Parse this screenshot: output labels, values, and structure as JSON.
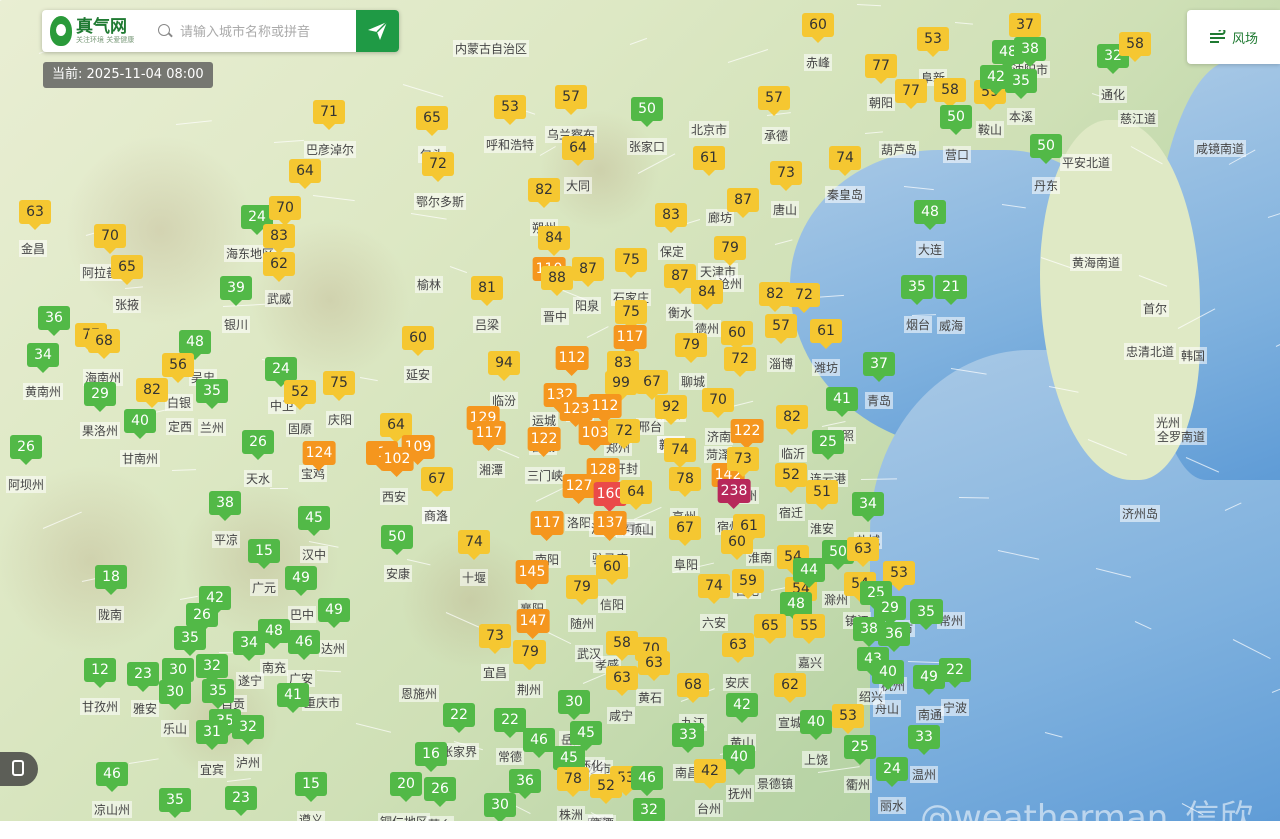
{
  "header": {
    "logo_name": "真气网",
    "logo_slogan": "关注环境 关爱健康",
    "search_placeholder": "请输入城市名称或拼音",
    "timestamp": "当前: 2025-11-04 08:00"
  },
  "controls": {
    "wind_label": "风场"
  },
  "watermark": "@weatherman_信欣",
  "colors": {
    "good": "#52b947",
    "moderate": "#f5c731",
    "light": "#f5961e",
    "medium": "#ea4a4a",
    "heavy": "#b7285a",
    "brand": "#1f9a45"
  },
  "aqi_markers": [
    {
      "v": "37"
    },
    {
      "v": "60"
    },
    {
      "v": "53"
    },
    {
      "v": "48"
    },
    {
      "v": "38"
    },
    {
      "v": "32"
    },
    {
      "v": "58"
    },
    {
      "v": "77"
    },
    {
      "v": "77"
    },
    {
      "v": "58"
    },
    {
      "v": "59"
    },
    {
      "v": "42"
    },
    {
      "v": "35"
    },
    {
      "v": "57"
    },
    {
      "v": "50"
    },
    {
      "v": "57"
    },
    {
      "v": "53"
    },
    {
      "v": "71"
    },
    {
      "v": "65"
    },
    {
      "v": "72"
    },
    {
      "v": "50"
    },
    {
      "v": "64"
    },
    {
      "v": "61"
    },
    {
      "v": "73"
    },
    {
      "v": "74"
    },
    {
      "v": "64"
    },
    {
      "v": "82"
    },
    {
      "v": "50"
    },
    {
      "v": "48"
    },
    {
      "v": "63"
    },
    {
      "v": "24"
    },
    {
      "v": "70"
    },
    {
      "v": "83"
    },
    {
      "v": "70"
    },
    {
      "v": "84"
    },
    {
      "v": "87"
    },
    {
      "v": "83"
    },
    {
      "v": "79"
    },
    {
      "v": "65"
    },
    {
      "v": "62"
    },
    {
      "v": "75"
    },
    {
      "v": "110"
    },
    {
      "v": "87"
    },
    {
      "v": "88"
    },
    {
      "v": "87"
    },
    {
      "v": "84"
    },
    {
      "v": "82"
    },
    {
      "v": "72"
    },
    {
      "v": "35"
    },
    {
      "v": "21"
    },
    {
      "v": "39"
    },
    {
      "v": "81"
    },
    {
      "v": "75"
    },
    {
      "v": "36"
    },
    {
      "v": "77"
    },
    {
      "v": "68"
    },
    {
      "v": "48"
    },
    {
      "v": "60"
    },
    {
      "v": "117"
    },
    {
      "v": "60"
    },
    {
      "v": "57"
    },
    {
      "v": "61"
    },
    {
      "v": "34"
    },
    {
      "v": "56"
    },
    {
      "v": "24"
    },
    {
      "v": "94"
    },
    {
      "v": "112"
    },
    {
      "v": "83"
    },
    {
      "v": "79"
    },
    {
      "v": "72"
    },
    {
      "v": "37"
    },
    {
      "v": "29"
    },
    {
      "v": "82"
    },
    {
      "v": "35"
    },
    {
      "v": "52"
    },
    {
      "v": "75"
    },
    {
      "v": "99"
    },
    {
      "v": "67"
    },
    {
      "v": "132"
    },
    {
      "v": "112"
    },
    {
      "v": "123"
    },
    {
      "v": "92"
    },
    {
      "v": "70"
    },
    {
      "v": "82"
    },
    {
      "v": "41"
    },
    {
      "v": "40"
    },
    {
      "v": "129"
    },
    {
      "v": "117"
    },
    {
      "v": "64"
    },
    {
      "v": "103"
    },
    {
      "v": "72"
    },
    {
      "v": "122"
    },
    {
      "v": "122"
    },
    {
      "v": "26"
    },
    {
      "v": "26"
    },
    {
      "v": "109"
    },
    {
      "v": "124"
    },
    {
      "v": "1"
    },
    {
      "v": "102"
    },
    {
      "v": "74"
    },
    {
      "v": "25"
    },
    {
      "v": "142"
    },
    {
      "v": "73"
    },
    {
      "v": "128"
    },
    {
      "v": "67"
    },
    {
      "v": "127"
    },
    {
      "v": "160"
    },
    {
      "v": "64"
    },
    {
      "v": "78"
    },
    {
      "v": "238"
    },
    {
      "v": "52"
    },
    {
      "v": "51"
    },
    {
      "v": "38"
    },
    {
      "v": "117"
    },
    {
      "v": "137"
    },
    {
      "v": "67"
    },
    {
      "v": "61"
    },
    {
      "v": "34"
    },
    {
      "v": "45"
    },
    {
      "v": "50"
    },
    {
      "v": "74"
    },
    {
      "v": "60"
    },
    {
      "v": "50"
    },
    {
      "v": "63"
    },
    {
      "v": "15"
    },
    {
      "v": "60"
    },
    {
      "v": "54"
    },
    {
      "v": "54"
    },
    {
      "v": "44"
    },
    {
      "v": "145"
    },
    {
      "v": "18"
    },
    {
      "v": "49"
    },
    {
      "v": "79"
    },
    {
      "v": "74"
    },
    {
      "v": "59"
    },
    {
      "v": "54"
    },
    {
      "v": "53"
    },
    {
      "v": "42"
    },
    {
      "v": "25"
    },
    {
      "v": "49"
    },
    {
      "v": "26"
    },
    {
      "v": "49"
    },
    {
      "v": "48"
    },
    {
      "v": "35"
    },
    {
      "v": "29"
    },
    {
      "v": "35"
    },
    {
      "v": "48"
    },
    {
      "v": "46"
    },
    {
      "v": "147"
    },
    {
      "v": "79"
    },
    {
      "v": "73"
    },
    {
      "v": "58"
    },
    {
      "v": "70"
    },
    {
      "v": "63"
    },
    {
      "v": "65"
    },
    {
      "v": "55"
    },
    {
      "v": "38"
    },
    {
      "v": "36"
    },
    {
      "v": "34"
    },
    {
      "v": "32"
    },
    {
      "v": "12"
    },
    {
      "v": "23"
    },
    {
      "v": "30"
    },
    {
      "v": "79"
    },
    {
      "v": "63"
    },
    {
      "v": "63"
    },
    {
      "v": "43"
    },
    {
      "v": "40"
    },
    {
      "v": "22"
    },
    {
      "v": "49"
    },
    {
      "v": "35"
    },
    {
      "v": "30"
    },
    {
      "v": "41"
    },
    {
      "v": "30"
    },
    {
      "v": "68"
    },
    {
      "v": "62"
    },
    {
      "v": "35"
    },
    {
      "v": "32"
    },
    {
      "v": "22"
    },
    {
      "v": "22"
    },
    {
      "v": "42"
    },
    {
      "v": "53"
    },
    {
      "v": "40"
    },
    {
      "v": "31"
    },
    {
      "v": "33"
    },
    {
      "v": "46"
    },
    {
      "v": "33"
    },
    {
      "v": "25"
    },
    {
      "v": "45"
    },
    {
      "v": "40"
    },
    {
      "v": "16"
    },
    {
      "v": "45"
    },
    {
      "v": "46"
    },
    {
      "v": "24"
    },
    {
      "v": "42"
    },
    {
      "v": "78"
    },
    {
      "v": "53"
    },
    {
      "v": "52"
    },
    {
      "v": "46"
    },
    {
      "v": "36"
    },
    {
      "v": "20"
    },
    {
      "v": "26"
    },
    {
      "v": "15"
    },
    {
      "v": "23"
    },
    {
      "v": "35"
    },
    {
      "v": "46"
    },
    {
      "v": "30"
    },
    {
      "v": "32"
    }
  ],
  "aqi_levels": [
    2,
    2,
    2,
    1,
    1,
    1,
    2,
    2,
    2,
    2,
    2,
    1,
    1,
    2,
    1,
    2,
    2,
    2,
    2,
    2,
    1,
    2,
    2,
    2,
    2,
    2,
    2,
    1,
    1,
    2,
    1,
    2,
    2,
    2,
    2,
    2,
    2,
    2,
    2,
    2,
    2,
    3,
    2,
    2,
    2,
    2,
    2,
    2,
    1,
    1,
    1,
    2,
    2,
    1,
    2,
    2,
    1,
    2,
    3,
    2,
    2,
    2,
    1,
    2,
    1,
    2,
    3,
    2,
    2,
    2,
    1,
    1,
    2,
    1,
    2,
    2,
    2,
    2,
    3,
    3,
    3,
    2,
    2,
    2,
    1,
    1,
    3,
    3,
    2,
    3,
    2,
    3,
    3,
    1,
    1,
    3,
    3,
    3,
    3,
    2,
    1,
    3,
    2,
    3,
    2,
    3,
    4,
    2,
    2,
    5,
    2,
    2,
    1,
    3,
    3,
    2,
    2,
    1,
    1,
    1,
    2,
    2,
    1,
    2,
    1,
    2,
    2,
    2,
    1,
    3,
    1,
    1,
    2,
    2,
    2,
    2,
    2,
    1,
    1,
    1,
    1,
    1,
    1,
    1,
    1,
    1,
    1,
    1,
    3,
    2,
    2,
    2,
    2,
    2,
    2,
    2,
    1,
    1,
    1,
    1,
    1,
    1,
    1,
    2,
    2,
    2,
    1,
    1,
    1,
    1,
    1,
    1,
    1,
    1,
    2,
    2,
    1,
    1,
    1,
    1,
    1,
    2,
    1,
    1,
    1,
    1,
    1,
    1,
    1,
    1,
    1,
    1,
    1,
    1,
    2,
    2,
    2,
    2,
    1,
    1,
    1,
    1,
    1,
    1,
    1,
    1,
    1,
    1
  ],
  "city_labels": [
    "内蒙古自治区",
    "赤峰",
    "阜新",
    "沈阳市",
    "通化",
    "丹东",
    "鞍山",
    "营口",
    "葫芦岛",
    "朝阳",
    "本溪",
    "平安北道",
    "慈江道",
    "咸镜南道",
    "北京市",
    "张家口",
    "承德",
    "秦皇岛",
    "唐山",
    "天津市",
    "廊坊",
    "保定",
    "沧州",
    "石家庄",
    "衡水",
    "德州",
    "阳泉",
    "晋中",
    "大同",
    "朔州",
    "呼和浩特",
    "乌兰察布",
    "包头",
    "巴彦淖尔",
    "鄂尔多斯",
    "榆林",
    "延安",
    "吕梁",
    "临汾",
    "运城",
    "长治",
    "晋城",
    "邯郸",
    "邢台",
    "聊城",
    "济南",
    "淄博",
    "潍坊",
    "青岛",
    "烟台",
    "威海",
    "大连",
    "黄海南道",
    "首尔",
    "忠清北道",
    "韩国",
    "光州",
    "全罗南道",
    "济州岛",
    "临沂",
    "日照",
    "连云港",
    "宿迁",
    "淮安",
    "盐城",
    "徐州",
    "宿州",
    "商丘",
    "亳州",
    "阜阳",
    "周口",
    "驻马店",
    "信阳",
    "南阳",
    "十堰",
    "襄阳",
    "随州",
    "孝感",
    "武汉",
    "荆州",
    "宜昌",
    "恩施州",
    "重庆市",
    "达州",
    "巴中",
    "广元",
    "汉中",
    "安康",
    "商洛",
    "西安",
    "宝鸡",
    "天水",
    "平凉",
    "庆阳",
    "固原",
    "中卫",
    "银川",
    "吴忠",
    "武威",
    "张掖",
    "金昌",
    "阿拉善盟",
    "海东地区",
    "海南州",
    "黄南州",
    "果洛州",
    "甘南州",
    "阿坝州",
    "陇南",
    "定西",
    "兰州",
    "白银",
    "雅安",
    "乐山",
    "宜宾",
    "泸州",
    "遂宁",
    "广安",
    "南充",
    "自贡",
    "凉山州",
    "甘孜州",
    "遵义",
    "铜仁地区",
    "张家界",
    "常德",
    "岳阳",
    "长沙市",
    "株洲",
    "宜春",
    "南昌",
    "九江",
    "黄石",
    "咸宁",
    "安庆",
    "合肥",
    "六安",
    "淮南",
    "蚌埠",
    "滁州",
    "镇江",
    "常州",
    "上海市",
    "南通",
    "宁波",
    "舟山",
    "绍兴",
    "杭州",
    "嘉兴",
    "宣城",
    "黄山",
    "景德镇",
    "上饶",
    "衢州",
    "丽水",
    "温州",
    "台州",
    "抚州",
    "鹰潭",
    "萍乡",
    "怀化",
    "湘潭",
    "三门峡",
    "洛阳",
    "平顶山",
    "漯河",
    "开封",
    "郑州",
    "焦作",
    "新乡",
    "菏泽",
    "济宁"
  ]
}
